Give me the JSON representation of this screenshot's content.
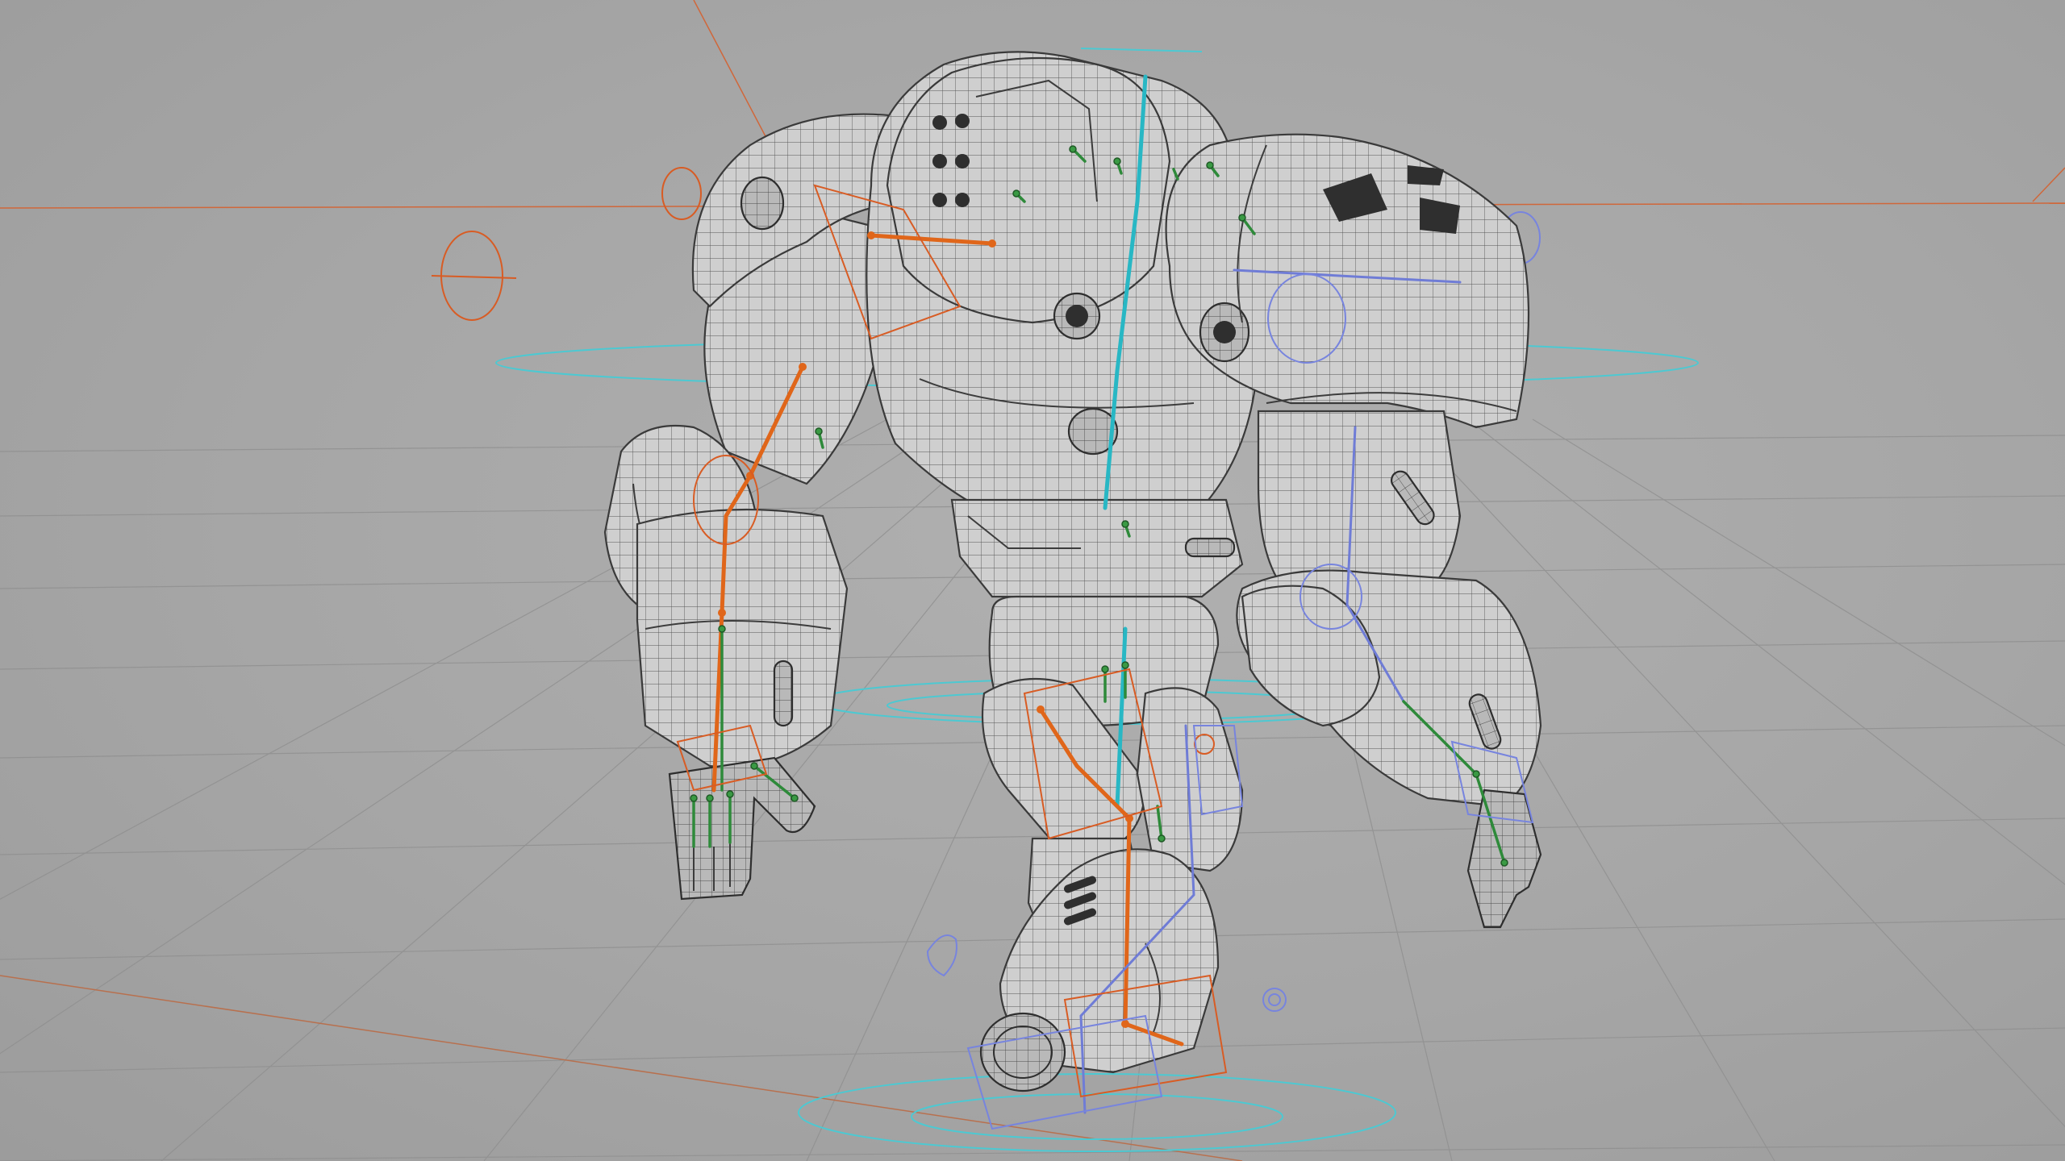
{
  "viewport": {
    "background": "#a6a6a6",
    "grid_color": "#8f8f8f",
    "axis_color": "#d0673a"
  },
  "model": {
    "display_mode": "wireframe-on-shaded",
    "mesh_color": "#c8c8c8",
    "wire_color": "#3a3a3a"
  },
  "rig": {
    "colors": {
      "left_side": "#e0661a",
      "right_side": "#6f7cd6",
      "spine": "#28b7c4",
      "fingers": "#2e8a3a"
    },
    "controls": [
      "head-control",
      "chest-control",
      "hip-control",
      "root-control",
      "left-hand-ik-control",
      "left-foot-ik-control",
      "right-hand-ik-control",
      "right-foot-ik-control"
    ]
  }
}
